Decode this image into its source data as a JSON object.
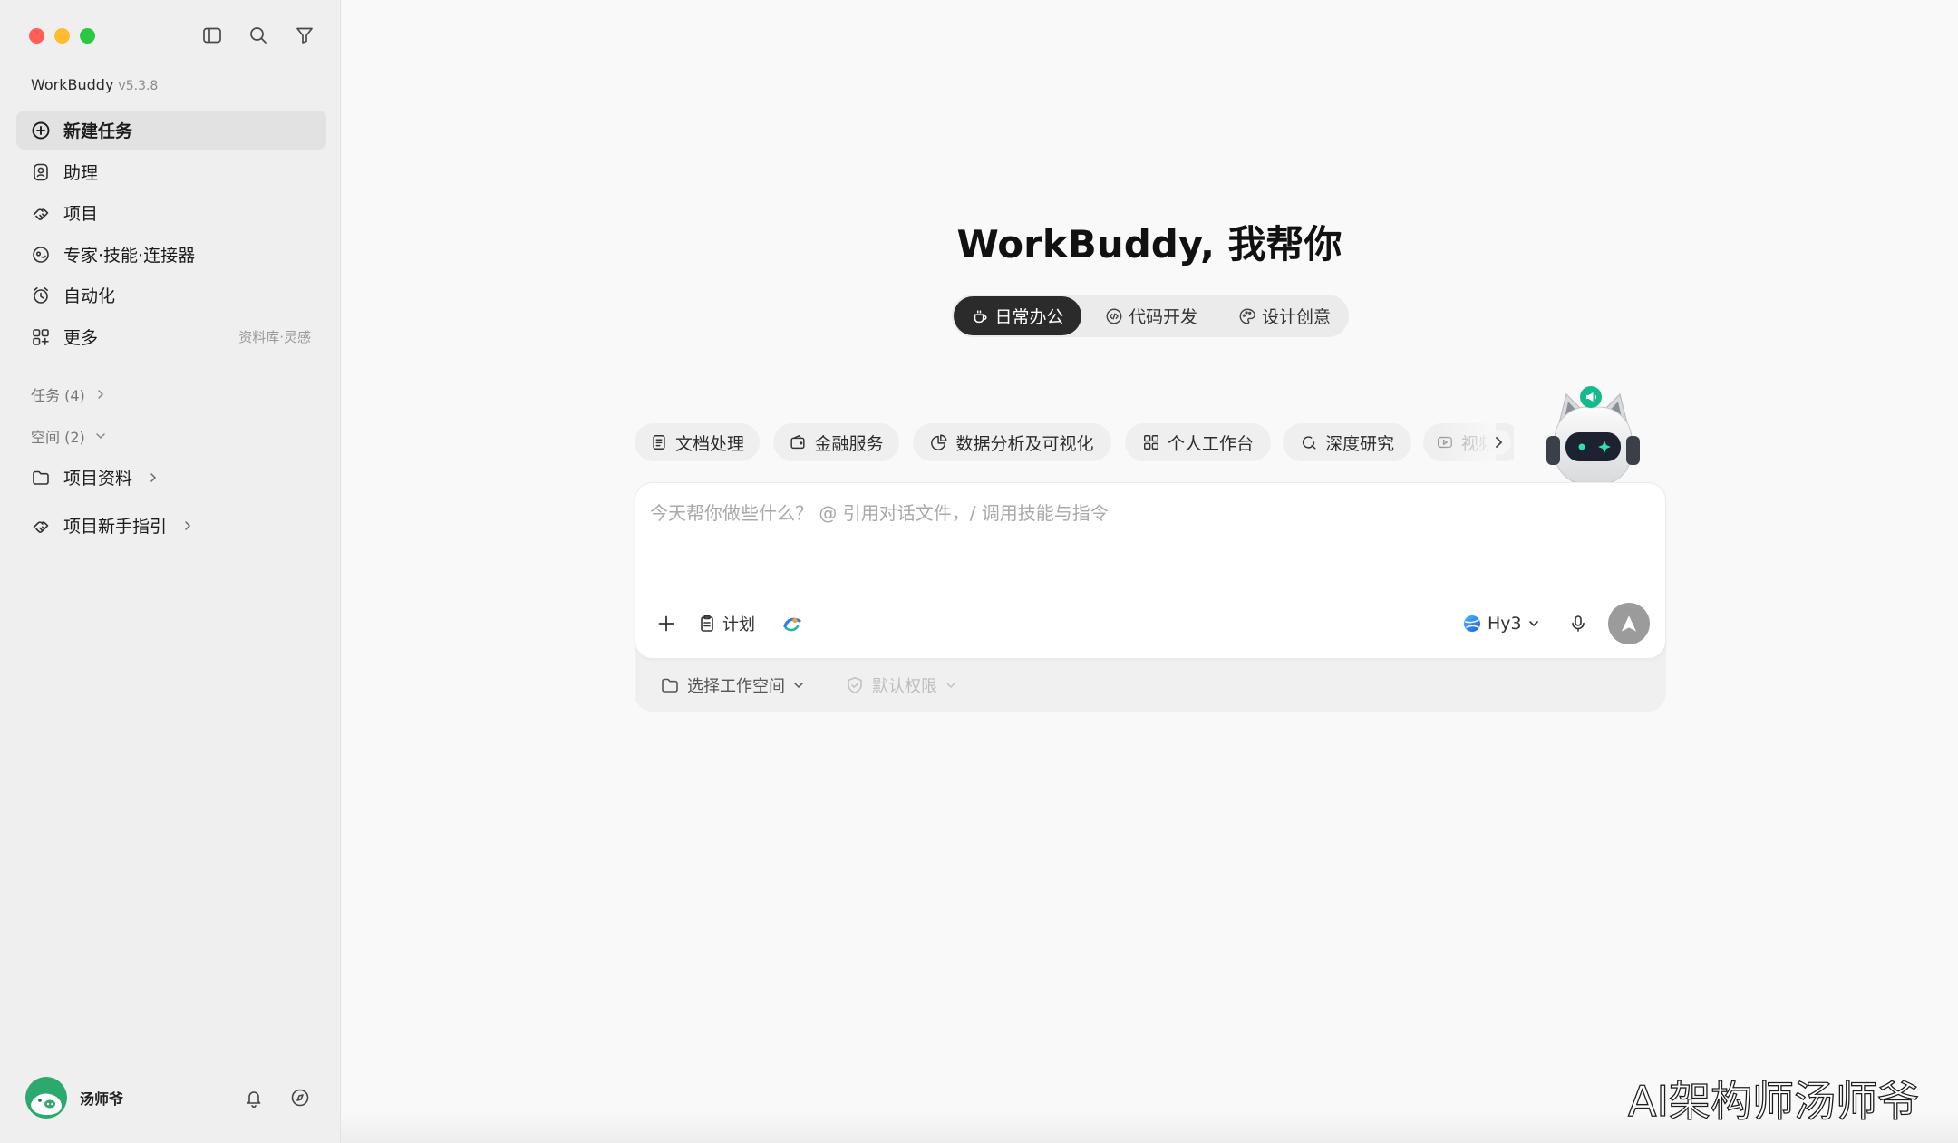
{
  "window": {
    "traffic_lights": {
      "close": "#ff5f57",
      "minimize": "#febc2e",
      "zoom": "#28c840"
    },
    "toolbar_icons": [
      "sidebar-toggle-icon",
      "search-icon",
      "filter-icon"
    ]
  },
  "app": {
    "name": "WorkBuddy",
    "version": "v5.3.8"
  },
  "sidebar": {
    "nav": [
      {
        "label": "新建任务",
        "icon": "plus-circle-icon",
        "active": true
      },
      {
        "label": "助理",
        "icon": "assistant-icon"
      },
      {
        "label": "项目",
        "icon": "project-icon"
      },
      {
        "label": "专家·技能·连接器",
        "icon": "expert-icon"
      },
      {
        "label": "自动化",
        "icon": "alarm-clock-icon"
      },
      {
        "label": "更多",
        "icon": "apps-icon",
        "hint": "资料库·灵感"
      }
    ],
    "tasks_header": "任务 (4)",
    "spaces_header": "空间 (2)",
    "spaces": [
      {
        "label": "项目资料",
        "icon": "folder-icon"
      },
      {
        "label": "项目新手指引",
        "icon": "guide-icon"
      }
    ],
    "user": {
      "name": "汤师爷",
      "actions": [
        "bell-icon",
        "compass-icon"
      ]
    }
  },
  "main": {
    "heading": "WorkBuddy, 我帮你",
    "modes": [
      {
        "label": "日常办公",
        "icon": "coffee-icon",
        "active": true
      },
      {
        "label": "代码开发",
        "icon": "code-icon"
      },
      {
        "label": "设计创意",
        "icon": "palette-icon"
      }
    ],
    "categories": [
      {
        "label": "文档处理",
        "icon": "document-icon"
      },
      {
        "label": "金融服务",
        "icon": "wallet-icon"
      },
      {
        "label": "数据分析及可视化",
        "icon": "pie-chart-icon"
      },
      {
        "label": "个人工作台",
        "icon": "grid-icon"
      },
      {
        "label": "深度研究",
        "icon": "research-icon"
      },
      {
        "label": "视频",
        "icon": "video-icon"
      }
    ],
    "composer": {
      "placeholder": "今天帮你做些什么？ @ 引用对话文件，/ 调用技能与指令",
      "plan_label": "计划",
      "model": "Hy3",
      "workspace": "选择工作空间",
      "permission": "默认权限"
    }
  },
  "watermark": "AI架构师汤师爷",
  "colors": {
    "active_mode": "#2b2b2b",
    "send_button": "#9b9b9b",
    "mascot_bubble": "#16b98c",
    "avatar": "#2ca96c"
  }
}
